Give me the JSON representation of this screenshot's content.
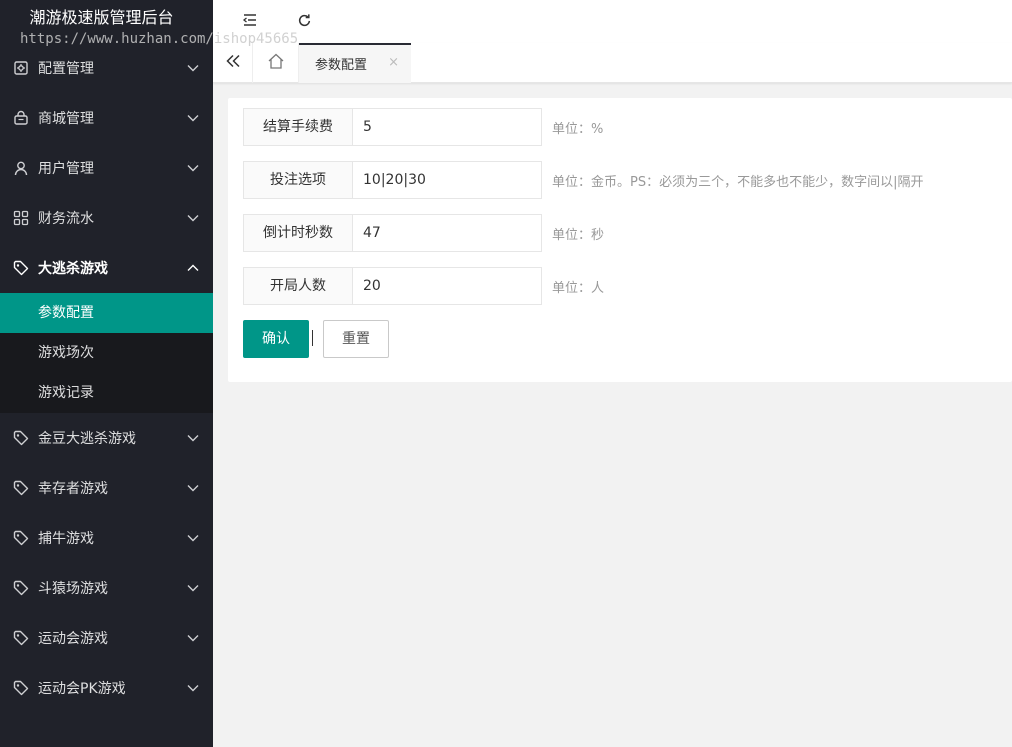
{
  "app": {
    "title": "潮游极速版管理后台",
    "watermark": "https://www.huzhan.com/ishop45665"
  },
  "sidebar": {
    "items": [
      {
        "label": "配置管理",
        "icon": "settings-panel-icon"
      },
      {
        "label": "商城管理",
        "icon": "shopping-bag-icon"
      },
      {
        "label": "用户管理",
        "icon": "user-icon"
      },
      {
        "label": "财务流水",
        "icon": "grid-apps-icon"
      },
      {
        "label": "大逃杀游戏",
        "icon": "tag-icon",
        "expanded": true
      },
      {
        "label": "金豆大逃杀游戏",
        "icon": "tag-icon"
      },
      {
        "label": "幸存者游戏",
        "icon": "tag-icon"
      },
      {
        "label": "捕牛游戏",
        "icon": "tag-icon"
      },
      {
        "label": "斗猿场游戏",
        "icon": "tag-icon"
      },
      {
        "label": "运动会游戏",
        "icon": "tag-icon"
      },
      {
        "label": "运动会PK游戏",
        "icon": "tag-icon"
      }
    ],
    "submenu": [
      {
        "label": "参数配置",
        "active": true
      },
      {
        "label": "游戏场次"
      },
      {
        "label": "游戏记录"
      }
    ]
  },
  "tabs": {
    "active_label": "参数配置",
    "close_glyph": "×"
  },
  "form": {
    "fields": [
      {
        "label": "结算手续费",
        "value": "5",
        "hint": "单位：%"
      },
      {
        "label": "投注选项",
        "value": "10|20|30",
        "hint": "单位：金币。PS：必须为三个，不能多也不能少，数字间以|隔开"
      },
      {
        "label": "倒计时秒数",
        "value": "47",
        "hint": "单位：秒"
      },
      {
        "label": "开局人数",
        "value": "20",
        "hint": "单位：人"
      }
    ],
    "submit_label": "确认",
    "reset_label": "重置"
  },
  "colors": {
    "sidebar_bg": "#20222a",
    "submenu_bg": "#18191d",
    "accent": "#009688"
  }
}
